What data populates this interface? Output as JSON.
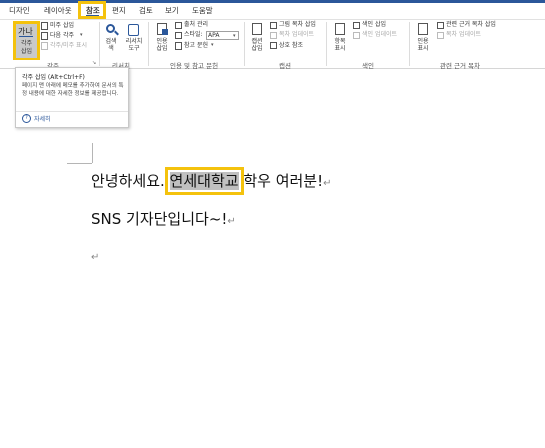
{
  "tabs": [
    "디자인",
    "레이아웃",
    "참조",
    "편지",
    "검토",
    "보기",
    "도움말"
  ],
  "groups": {
    "notes": {
      "big_icon_text": "가나",
      "big_label_1": "각주",
      "big_label_2": "삽입",
      "small1": "미주 삽입",
      "small2": "다음 각주",
      "small3": "각주/미주 표시",
      "label": "각주"
    },
    "research": {
      "search": "검색",
      "search_sub": "색",
      "researcher": "리서치",
      "researcher_sub": "도구",
      "label": "리서치"
    },
    "citations": {
      "insert_citation": "인용",
      "insert_citation_sub": "삽입",
      "manage": "출처 관리",
      "style_label": "스타일:",
      "style_value": "APA",
      "bibliography": "참고 문헌",
      "label": "인용 및 참고 문헌"
    },
    "captions": {
      "insert_caption": "캡션",
      "insert_caption_sub": "삽입",
      "small1": "그림 목차 삽입",
      "small2": "목차 업데이트",
      "small3": "상호 참조",
      "label": "캡션"
    },
    "index": {
      "mark_entry": "항목",
      "mark_entry_sub": "표시",
      "small1": "색인 삽입",
      "small2": "색인 업데이트",
      "label": "색인"
    },
    "authorities": {
      "mark_citation": "인용",
      "mark_citation_sub": "표시",
      "small1": "관련 근거 목차 삽입",
      "small2": "목차 업데이트",
      "label": "관련 근거 목차"
    }
  },
  "tooltip": {
    "title": "각주 삽입 (Alt+Ctrl+F)",
    "body": "페이지 맨 아래에 메모를 추가하여 문서의 특정 내용에 대한 자세한 정보를 제공합니다.",
    "more": "자세히"
  },
  "document": {
    "line1_before": "안녕하세요. ",
    "line1_highlight": "연세대학교",
    "line1_after": " 학우 여러분!",
    "line2": "SNS 기자단입니다~!",
    "para_mark": "↵"
  },
  "colors": {
    "accent": "#2b579a",
    "highlight_border": "#f4c20d",
    "text_highlight": "#c0c0c0"
  }
}
